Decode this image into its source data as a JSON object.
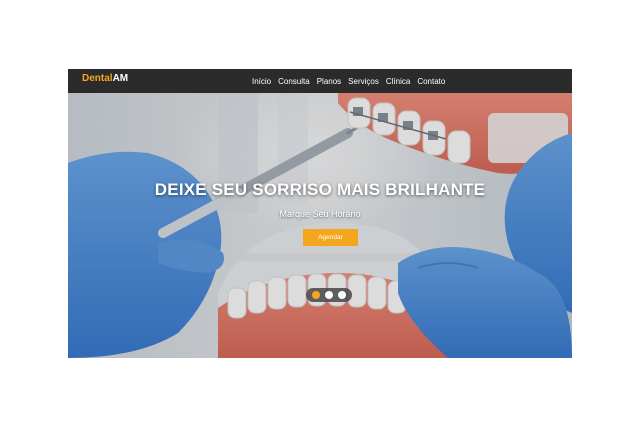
{
  "brand": {
    "name_part1": "Dental",
    "name_part2": "AM"
  },
  "nav": {
    "items": [
      {
        "label": "Início"
      },
      {
        "label": "Consulta"
      },
      {
        "label": "Planos"
      },
      {
        "label": "Serviços"
      },
      {
        "label": "Clínica"
      },
      {
        "label": "Contato"
      }
    ]
  },
  "hero": {
    "title": "DEIXE SEU SORRISO MAIS BRILHANTE",
    "subtitle": "Marque Seu Horário",
    "cta_label": "Agendar",
    "slide_count": 3,
    "active_slide": 1
  },
  "colors": {
    "accent": "#f4a71d",
    "navbar": "#2b2b2b",
    "text_light": "#ffffff"
  }
}
